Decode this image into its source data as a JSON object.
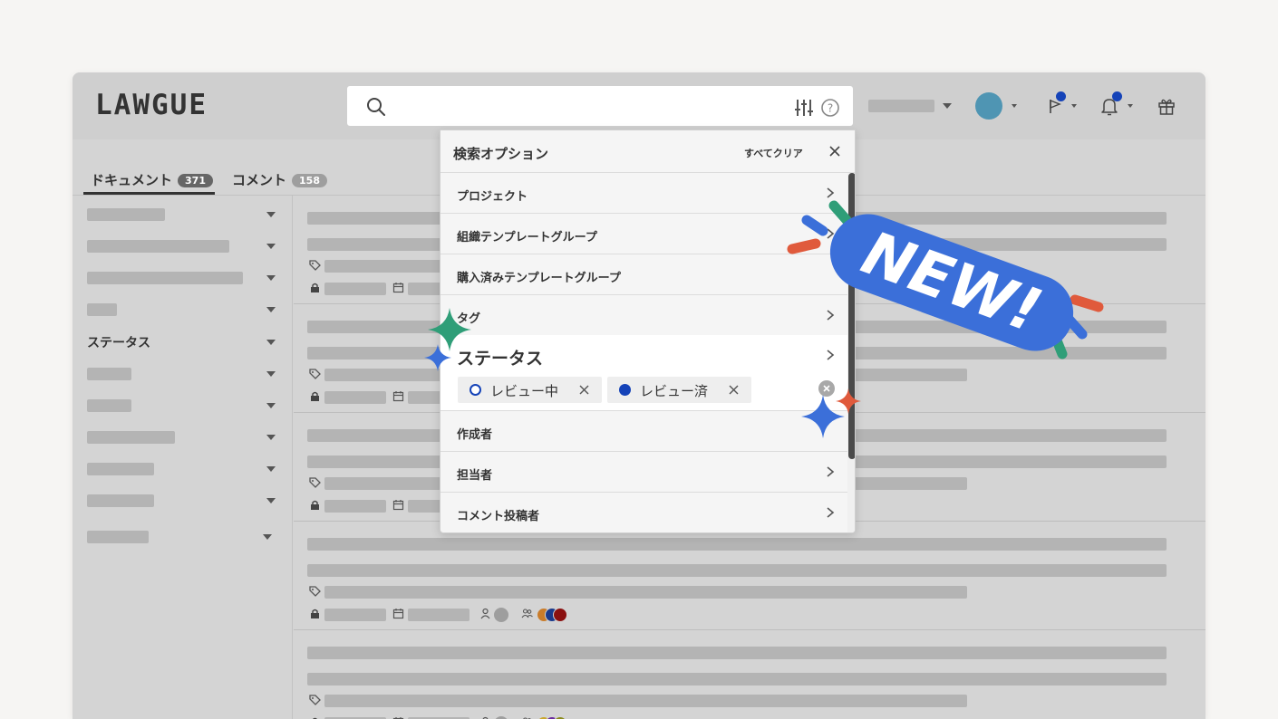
{
  "app": {
    "logo": "LAWGUE"
  },
  "colors": {
    "accent_blue": "#3b6fd9",
    "green": "#2f9e78",
    "red": "#e05a3c",
    "dark_blue": "#1543b8"
  },
  "tabs": [
    {
      "label": "ドキュメント",
      "count": "371"
    },
    {
      "label": "コメント",
      "count": "158"
    }
  ],
  "sidebar": {
    "status_label": "ステータス"
  },
  "dropdown": {
    "title": "検索オプション",
    "clear_all": "すべてクリア",
    "items": [
      {
        "label": "プロジェクト"
      },
      {
        "label": "組織テンプレートグループ"
      },
      {
        "label": "購入済みテンプレートグループ"
      },
      {
        "label": "タグ"
      },
      {
        "label": "ステータス"
      },
      {
        "label": "作成者"
      },
      {
        "label": "担当者"
      },
      {
        "label": "コメント投稿者"
      }
    ],
    "chips": [
      {
        "label": "レビュー中",
        "style": "outline"
      },
      {
        "label": "レビュー済",
        "style": "filled"
      }
    ]
  },
  "sticker": {
    "text": "NEW!"
  },
  "icons": [
    "search-icon",
    "sliders-icon",
    "help-icon",
    "flag-icon",
    "bell-icon",
    "gift-icon",
    "close-icon",
    "chevron-right-icon",
    "tag-icon",
    "lock-icon",
    "calendar-icon",
    "user-icon",
    "users-icon",
    "sparkle-icon"
  ]
}
